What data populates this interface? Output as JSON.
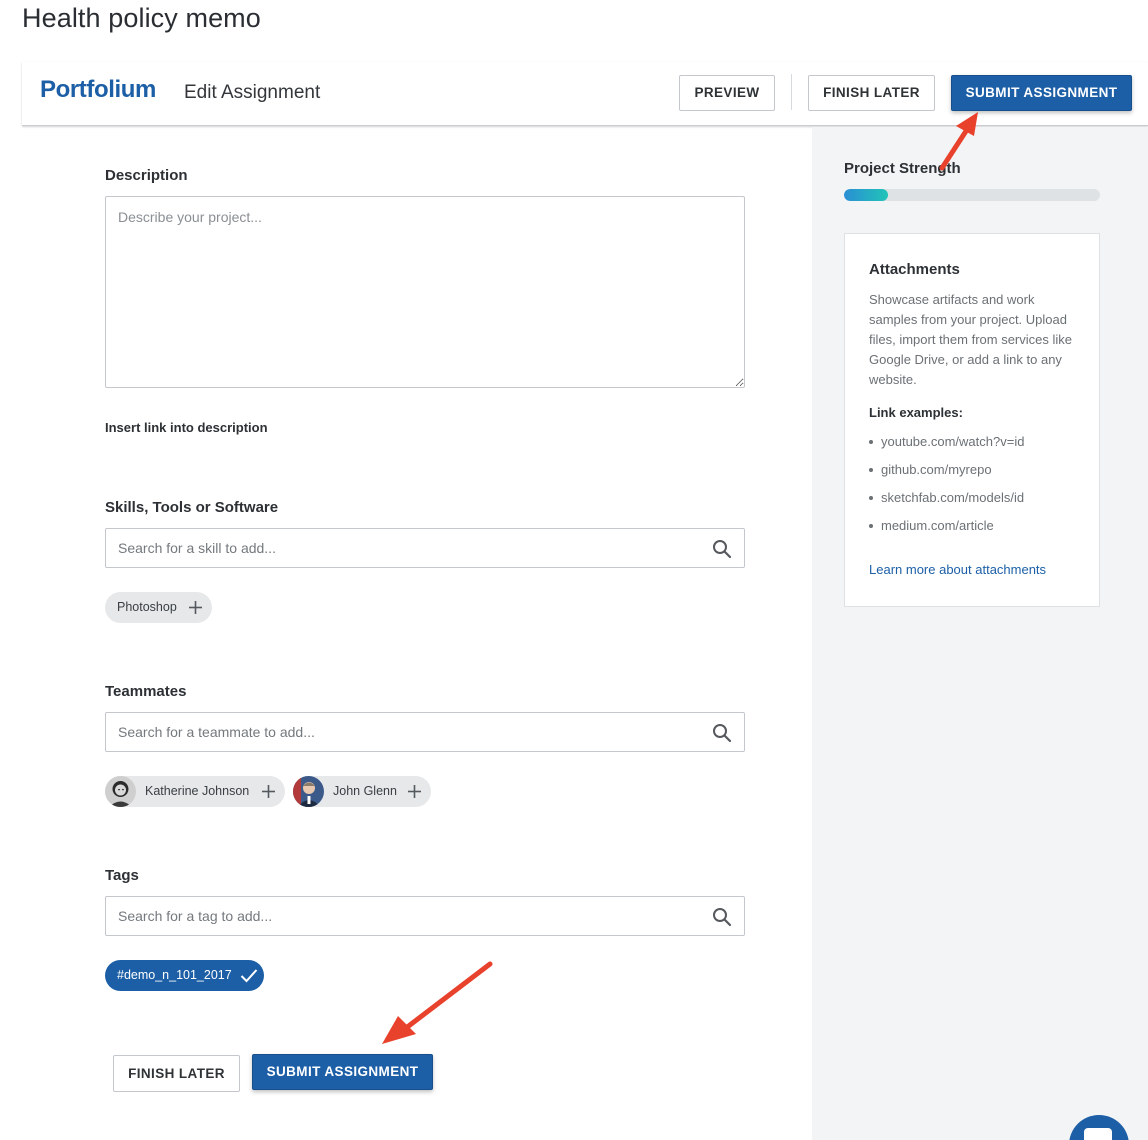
{
  "page": {
    "title": "Health policy memo"
  },
  "header": {
    "logo": "Portfolium",
    "title": "Edit Assignment",
    "preview_label": "PREVIEW",
    "finish_later_label": "FINISH LATER",
    "submit_label": "SUBMIT ASSIGNMENT"
  },
  "form": {
    "description": {
      "label": "Description",
      "placeholder": "Describe your project...",
      "value": "",
      "insert_link_label": "Insert link into description"
    },
    "skills": {
      "label": "Skills, Tools or Software",
      "placeholder": "Search for a skill to add...",
      "suggestions": [
        "Photoshop"
      ]
    },
    "teammates": {
      "label": "Teammates",
      "placeholder": "Search for a teammate to add...",
      "suggestions": [
        "Katherine Johnson",
        "John Glenn"
      ]
    },
    "tags": {
      "label": "Tags",
      "placeholder": "Search for a tag to add...",
      "selected": [
        "#demo_n_101_2017"
      ]
    },
    "actions": {
      "finish_later_label": "FINISH LATER",
      "submit_label": "SUBMIT ASSIGNMENT"
    }
  },
  "sidebar": {
    "strength_label": "Project Strength",
    "strength_value": 0.17,
    "attachments": {
      "title": "Attachments",
      "description": "Showcase artifacts and work samples from your project. Upload files, import them from services like Google Drive, or add a link to any website.",
      "examples_label": "Link examples:",
      "examples": [
        "youtube.com/watch?v=id",
        "github.com/myrepo",
        "sketchfab.com/models/id",
        "medium.com/article"
      ],
      "learn_more": "Learn more about attachments"
    }
  },
  "colors": {
    "brand": "#1c5fa6",
    "annotation_arrow": "#e8412c",
    "strength_gradient_start": "#2a8fd4",
    "strength_gradient_end": "#22c4b8"
  },
  "icons": [
    "search-icon",
    "plus-icon",
    "check-icon",
    "chat-icon",
    "annotation-arrow"
  ]
}
